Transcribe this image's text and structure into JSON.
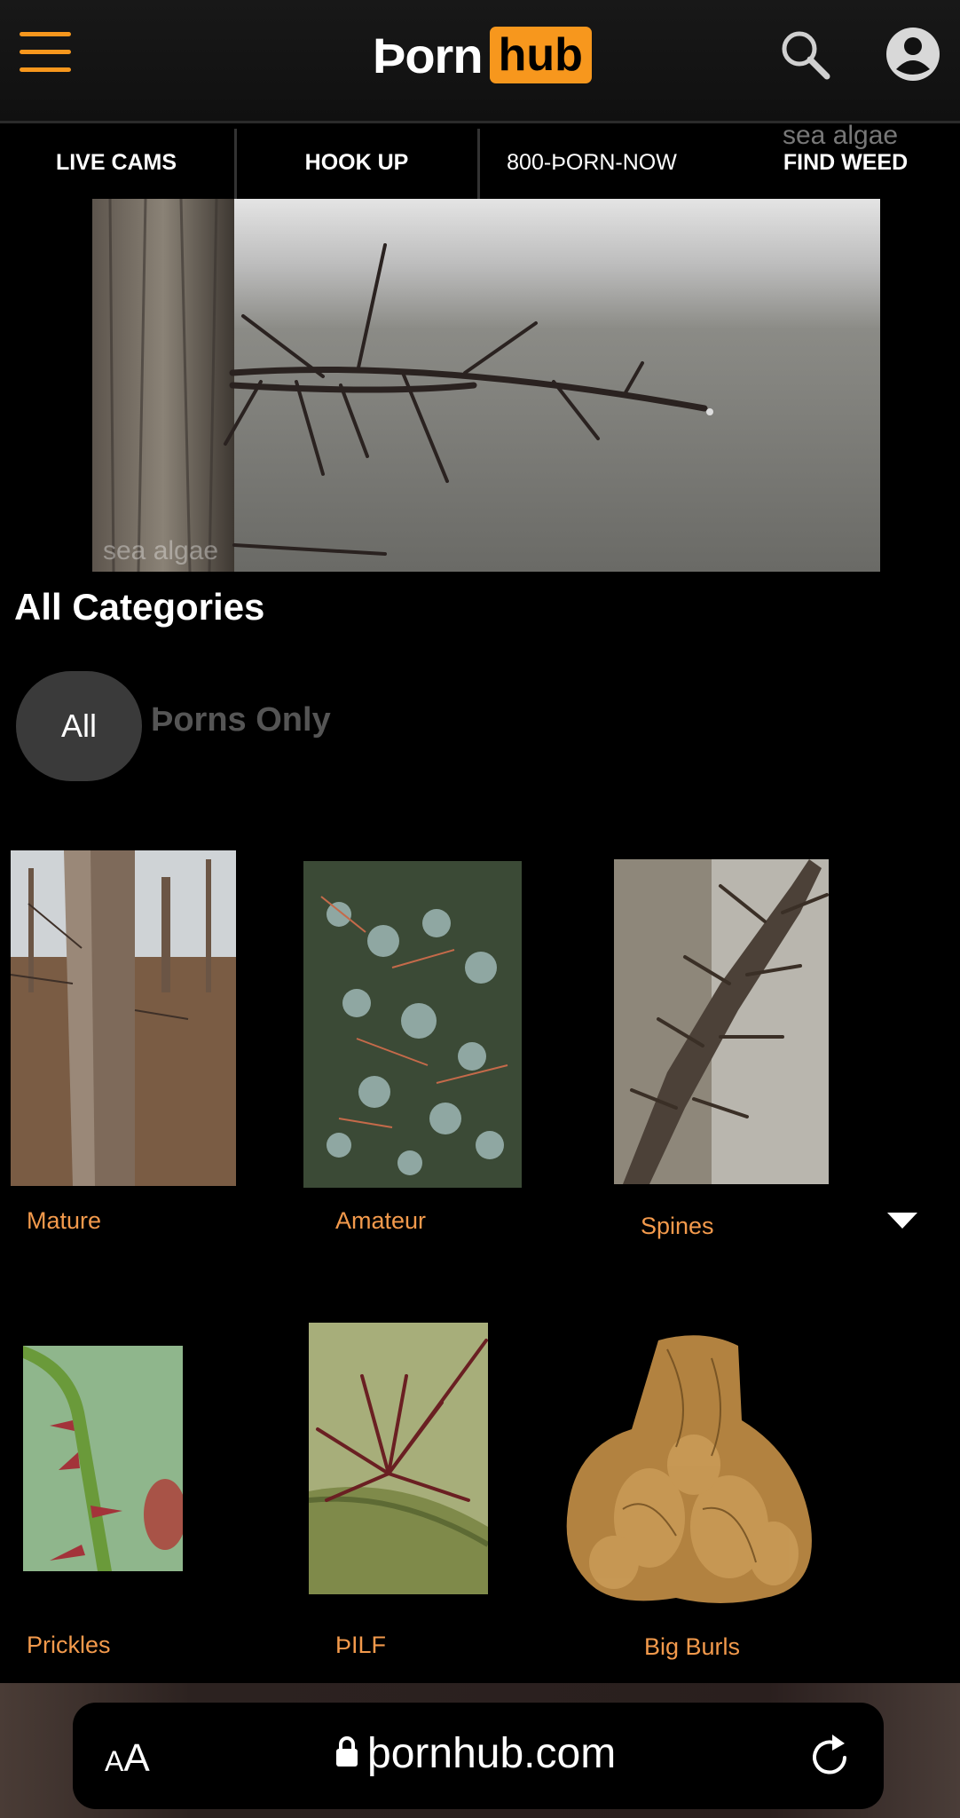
{
  "header": {
    "logo_left": "Þorn",
    "logo_right": "hub",
    "accent_color": "#f7971d",
    "icons": [
      "hamburger-menu-icon",
      "search-icon",
      "user-account-icon"
    ]
  },
  "nav": {
    "items": [
      "LIVE CAMS",
      "HOOK UP",
      "800-ÞORN-NOW",
      "FIND WEED"
    ],
    "hint": "sea algae"
  },
  "hero": {
    "caption": "sea algae"
  },
  "categories": {
    "title": "All Categories",
    "filters": [
      "All",
      "Þorns Only"
    ],
    "items": [
      {
        "label": "Mature"
      },
      {
        "label": "Amateur"
      },
      {
        "label": "Spines"
      },
      {
        "label": "Prickles"
      },
      {
        "label": "ÞILF"
      },
      {
        "label": "Big Burls"
      }
    ]
  },
  "browser": {
    "aa_big": "A",
    "aa_small": "A",
    "url": "þornhub.com",
    "icons": [
      "lock-icon",
      "reload-icon"
    ]
  }
}
